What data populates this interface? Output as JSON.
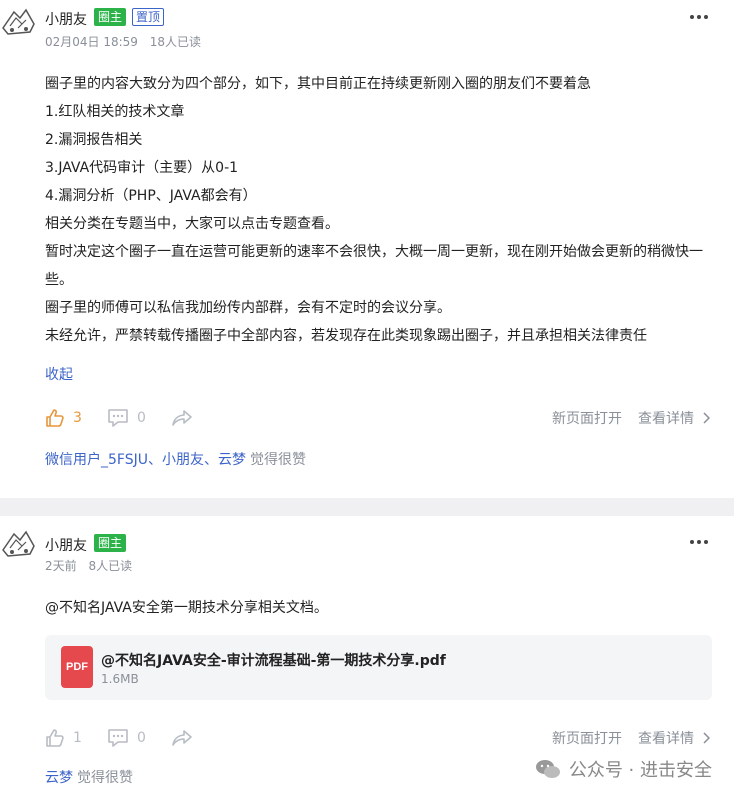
{
  "post1": {
    "author": "小朋友",
    "badge_owner": "圈主",
    "badge_pinned": "置顶",
    "date": "02月04日 18:59",
    "reads": "18人已读",
    "paragraphs": [
      "圈子里的内容大致分为四个部分，如下，其中目前正在持续更新刚入圈的朋友们不要着急",
      "1.红队相关的技术文章",
      "2.漏洞报告相关",
      "3.JAVA代码审计（主要）从0-1",
      "4.漏洞分析（PHP、JAVA都会有）",
      "相关分类在专题当中，大家可以点击专题查看。",
      "暂时决定这个圈子一直在运营可能更新的速率不会很快，大概一周一更新，现在刚开始做会更新的稍微快一些。",
      "圈子里的师傅可以私信我加纷传内部群，会有不定时的会议分享。",
      "未经允许，严禁转载传播圈子中全部内容，若发现存在此类现象踢出圈子，并且承担相关法律责任"
    ],
    "collapse_label": "收起",
    "likes": "3",
    "comments": "0",
    "open_new_page": "新页面打开",
    "view_details": "查看详情",
    "likers": "微信用户_5FSJU、小朋友、云梦",
    "likers_tail": "觉得很赞"
  },
  "post2": {
    "author": "小朋友",
    "badge_owner": "圈主",
    "date": "2天前",
    "reads": "8人已读",
    "text": "@不知名JAVA安全第一期技术分享相关文档。",
    "file": {
      "icon_label": "PDF",
      "name": "@不知名JAVA安全-审计流程基础-第一期技术分享.pdf",
      "size": "1.6MB"
    },
    "likes": "1",
    "comments": "0",
    "open_new_page": "新页面打开",
    "view_details": "查看详情",
    "likers": "云梦",
    "likers_tail": "觉得很赞"
  },
  "watermark": "公众号 · 进击安全",
  "colors": {
    "accent_blue": "#3d64c9",
    "owner_green": "#2bb34a",
    "like_orange": "#e8963c",
    "pdf_red": "#e5484d"
  }
}
